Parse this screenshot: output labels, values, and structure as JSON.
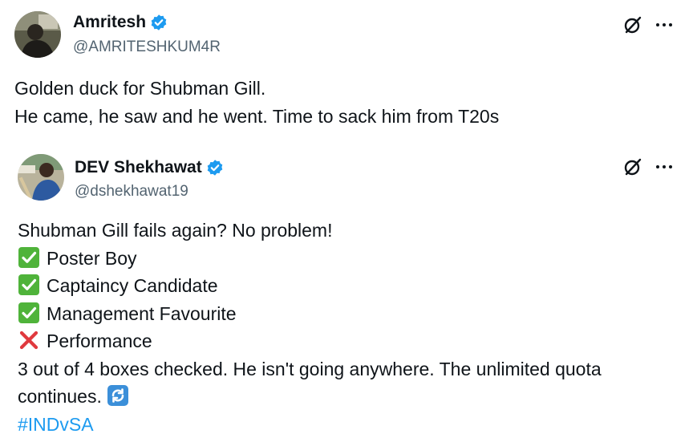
{
  "tweets": [
    {
      "display_name": "Amritesh",
      "handle": "@AMRITESHKUM4R",
      "avatar_icon": "user-avatar",
      "verified_icon": "verified-badge-icon",
      "body_lines": [
        "Golden duck for Shubman Gill.",
        "He came, he saw and he went. Time to sack him from T20s"
      ]
    },
    {
      "display_name": "DEV Shekhawat",
      "handle": "@dshekhawat19",
      "avatar_icon": "user-avatar",
      "verified_icon": "verified-badge-icon",
      "body_lines": [
        "Shubman Gill fails again? No problem!",
        "Poster Boy",
        "Captaincy Candidate",
        "Management Favourite",
        "Performance",
        "3 out of 4 boxes checked. He isn't going anywhere. The unlimited quota",
        "continues.",
        "#INDvSA"
      ],
      "line_icons": [
        "",
        "check-mark-emoji",
        "check-mark-emoji",
        "check-mark-emoji",
        "cross-mark-emoji",
        "",
        "arrows-cycle-emoji",
        ""
      ]
    }
  ],
  "colors": {
    "text": "#0f1419",
    "secondary": "#536471",
    "accent": "#1d9bf0",
    "check_green": "#4fb33a",
    "cross_red": "#e0393e"
  }
}
